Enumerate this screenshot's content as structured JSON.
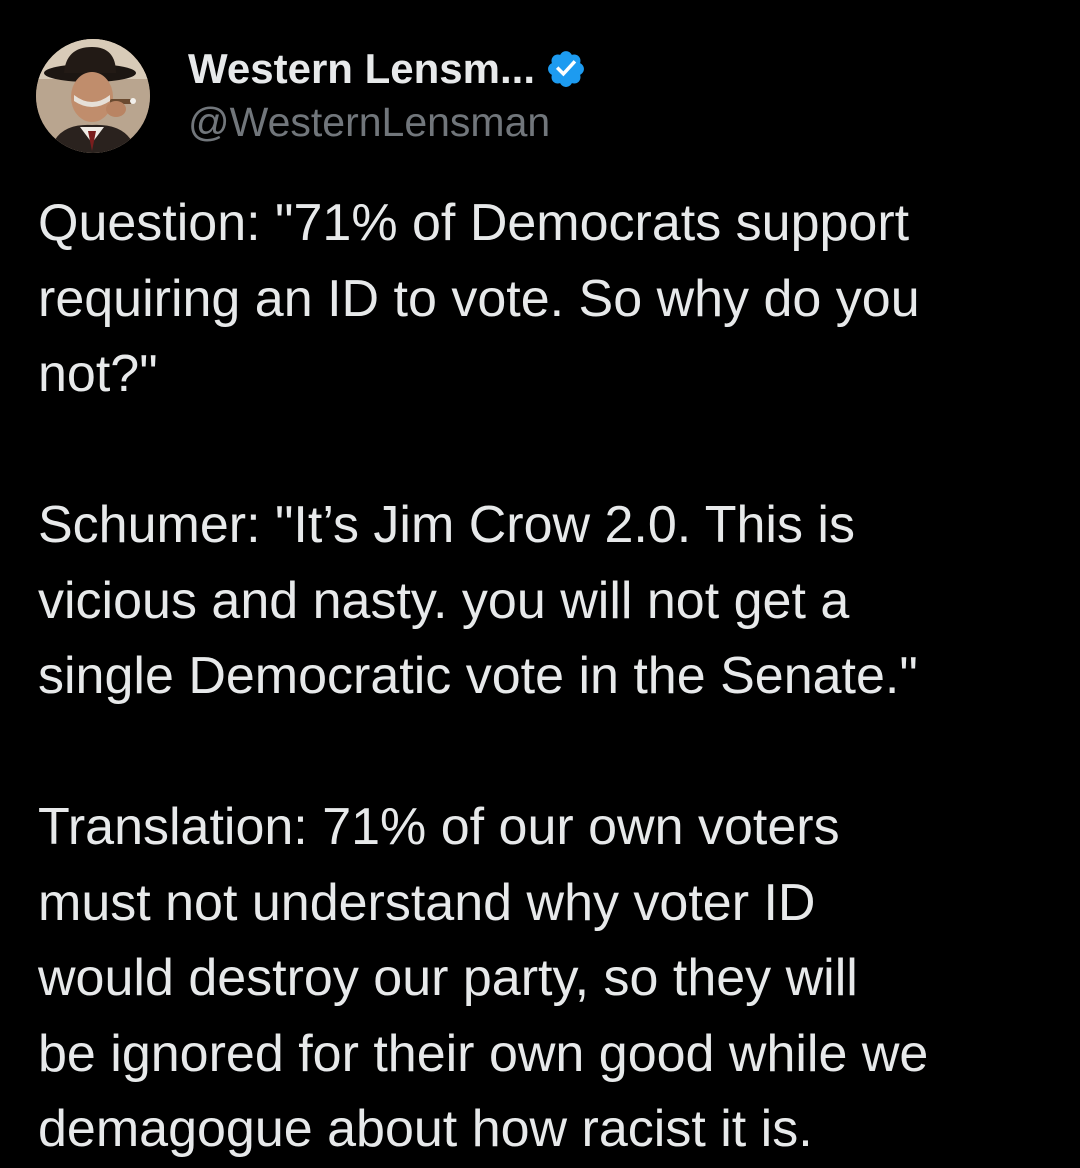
{
  "tweet": {
    "author": {
      "display_name": "Western Lensm...",
      "handle": "@WesternLensman",
      "verified": true,
      "verified_icon": "verified-badge-icon",
      "verified_color": "#1d9bf0",
      "avatar": "avatar-image"
    },
    "paragraphs": [
      "Question: \"71% of Democrats support\nrequiring an ID to vote. So why do you\nnot?\"",
      "Schumer: \"It’s Jim Crow 2.0. This is\nvicious and nasty. you will not get a\nsingle Democratic vote in the Senate.\"",
      "Translation: 71% of our own voters\nmust not understand why voter ID\nwould destroy our party, so they will\nbe ignored for their own good while we\ndemagogue about how racist it is."
    ]
  },
  "colors": {
    "background": "#000000",
    "primary_text": "#e7e9ea",
    "secondary_text": "#71767b",
    "accent": "#1d9bf0"
  }
}
